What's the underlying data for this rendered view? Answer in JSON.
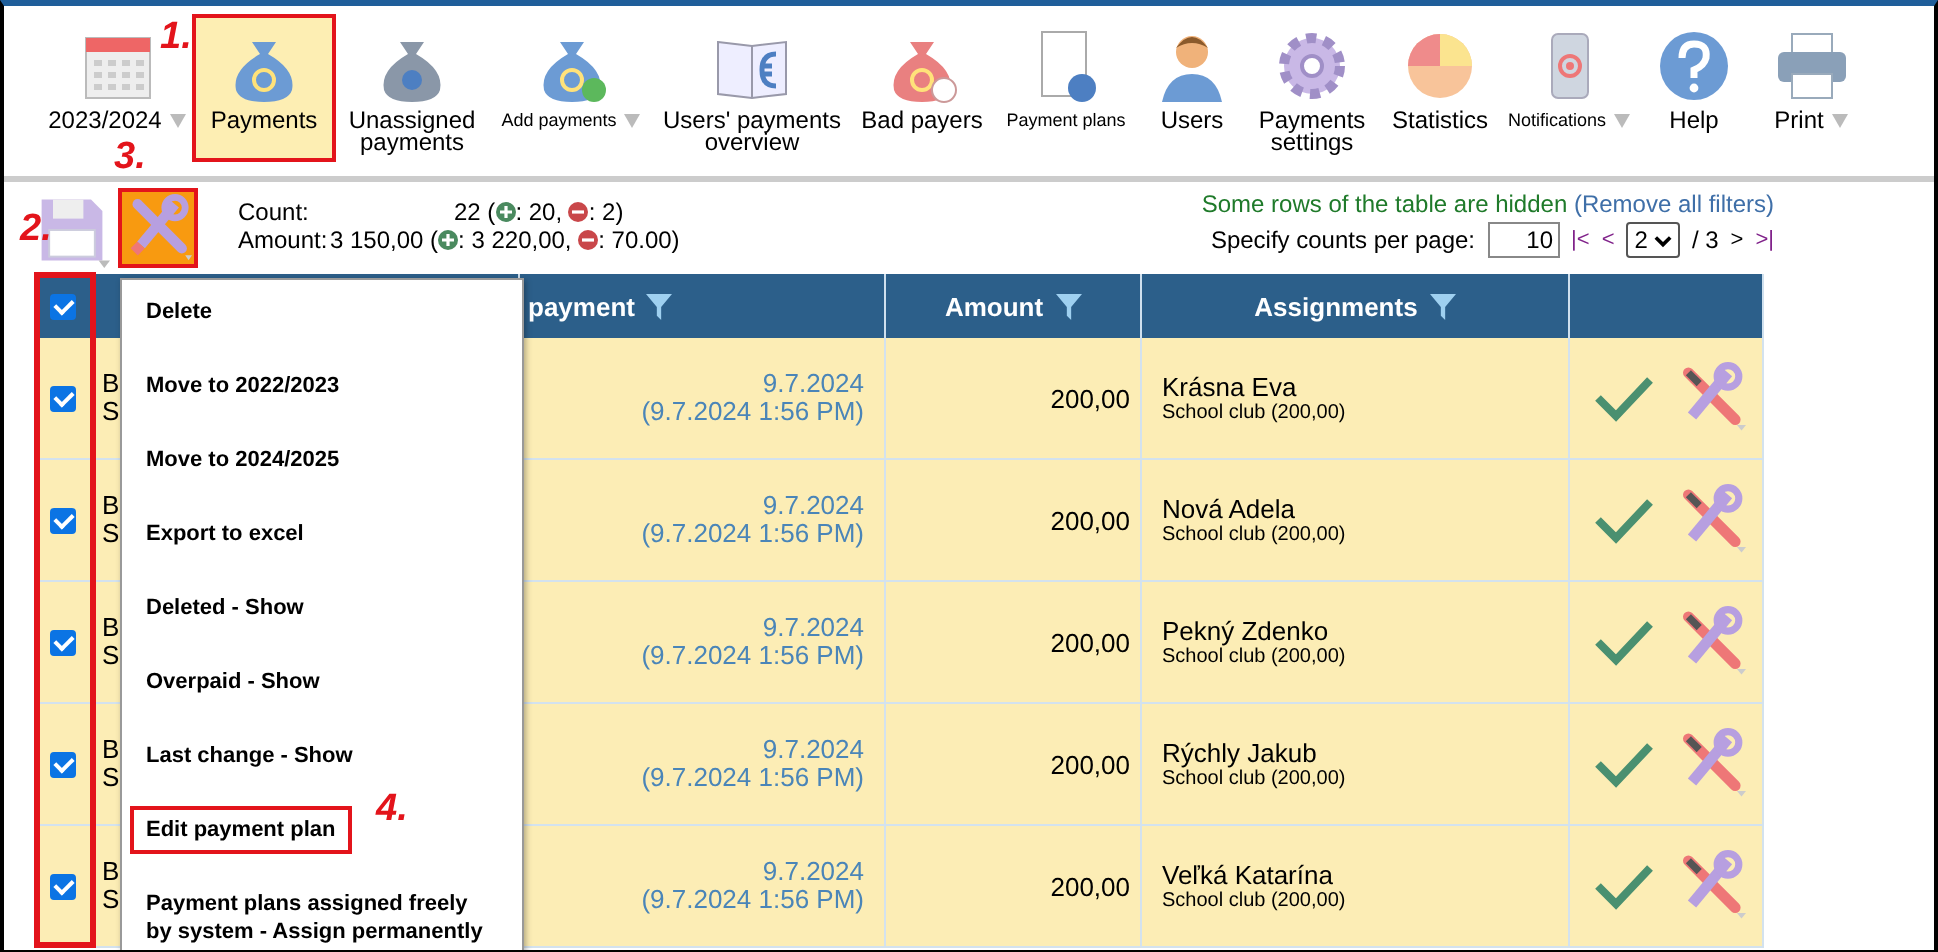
{
  "toolbar": [
    {
      "label": "2023/2024",
      "selected": false,
      "small": false,
      "dropdown": true,
      "highlighted": false
    },
    {
      "label": "Payments",
      "selected": true,
      "small": false,
      "dropdown": false,
      "highlighted": true
    },
    {
      "label": "Unassigned payments",
      "selected": false,
      "small": false,
      "dropdown": false,
      "highlighted": false
    },
    {
      "label": "Add payments",
      "selected": false,
      "small": true,
      "dropdown": true,
      "highlighted": false
    },
    {
      "label": "Users' payments overview",
      "selected": false,
      "small": false,
      "dropdown": false,
      "highlighted": false
    },
    {
      "label": "Bad payers",
      "selected": false,
      "small": false,
      "dropdown": false,
      "highlighted": false
    },
    {
      "label": "Payment plans",
      "selected": false,
      "small": true,
      "dropdown": false,
      "highlighted": false
    },
    {
      "label": "Users",
      "selected": false,
      "small": false,
      "dropdown": false,
      "highlighted": false
    },
    {
      "label": "Payments settings",
      "selected": false,
      "small": false,
      "dropdown": false,
      "highlighted": false
    },
    {
      "label": "Statistics",
      "selected": false,
      "small": false,
      "dropdown": false,
      "highlighted": false
    },
    {
      "label": "Notifications",
      "selected": false,
      "small": true,
      "dropdown": true,
      "highlighted": false
    },
    {
      "label": "Help",
      "selected": false,
      "small": false,
      "dropdown": false,
      "highlighted": false
    },
    {
      "label": "Print",
      "selected": false,
      "small": false,
      "dropdown": true,
      "highlighted": false
    }
  ],
  "actions": {
    "tools_active": true,
    "tools_highlighted": true
  },
  "summary": {
    "count_label": "Count:",
    "count_total": "22 (",
    "count_plus": ": 20,",
    "count_minus": ": 2)",
    "amount_label": "Amount:",
    "amount_total": "3 150,00 (",
    "amount_plus": ": 3 220,00,",
    "amount_minus": ": 70.00)"
  },
  "filter_notice": {
    "text": "Some rows of the table are hidden",
    "link": "(Remove all filters)"
  },
  "pagination": {
    "label": "Specify counts per page:",
    "per_page": "10",
    "first": "|<",
    "prev": "<",
    "page": "2",
    "total": "/ 3",
    "next": ">",
    "last": ">|"
  },
  "table": {
    "select_all_checked": true,
    "checkbox_column_highlighted": true,
    "columns": [
      {
        "label": "payment",
        "filter": true
      },
      {
        "label": "Amount",
        "filter": true
      },
      {
        "label": "Assignments",
        "filter": true
      }
    ],
    "rows": [
      {
        "checked": true,
        "column_2": [
          "B",
          "S"
        ],
        "date": "9.7.2024",
        "datetime": "(9.7.2024 1:56 PM)",
        "amount": "200,00",
        "name": "Krásna Eva",
        "detail": "School club (200,00)"
      },
      {
        "checked": true,
        "column_2": [
          "B",
          "S"
        ],
        "date": "9.7.2024",
        "datetime": "(9.7.2024 1:56 PM)",
        "amount": "200,00",
        "name": "Nová Adela",
        "detail": "School club (200,00)"
      },
      {
        "checked": true,
        "column_2": [
          "B",
          "S"
        ],
        "date": "9.7.2024",
        "datetime": "(9.7.2024 1:56 PM)",
        "amount": "200,00",
        "name": "Pekný Zdenko",
        "detail": "School club (200,00)"
      },
      {
        "checked": true,
        "column_2": [
          "B",
          "S"
        ],
        "date": "9.7.2024",
        "datetime": "(9.7.2024 1:56 PM)",
        "amount": "200,00",
        "name": "Rýchly Jakub",
        "detail": "School club (200,00)"
      },
      {
        "checked": true,
        "column_2": [
          "B",
          "S"
        ],
        "date": "9.7.2024",
        "datetime": "(9.7.2024 1:56 PM)",
        "amount": "200,00",
        "name": "Veľká Katarína",
        "detail": "School club (200,00)"
      }
    ]
  },
  "menu": [
    {
      "label": "Delete",
      "highlighted": false
    },
    {
      "label": "Move to 2022/2023",
      "highlighted": false
    },
    {
      "label": "Move to 2024/2025",
      "highlighted": false
    },
    {
      "label": "Export to excel",
      "highlighted": false
    },
    {
      "label": "Deleted - Show",
      "highlighted": false
    },
    {
      "label": "Overpaid - Show",
      "highlighted": false
    },
    {
      "label": "Last change - Show",
      "highlighted": false
    },
    {
      "label": "Edit payment plan",
      "highlighted": true
    },
    {
      "label": "Payment plans assigned freely by system - Assign permanently",
      "highlighted": false
    }
  ],
  "annotations": [
    {
      "label": "1."
    },
    {
      "label": "2."
    },
    {
      "label": "3."
    },
    {
      "label": "4."
    }
  ]
}
